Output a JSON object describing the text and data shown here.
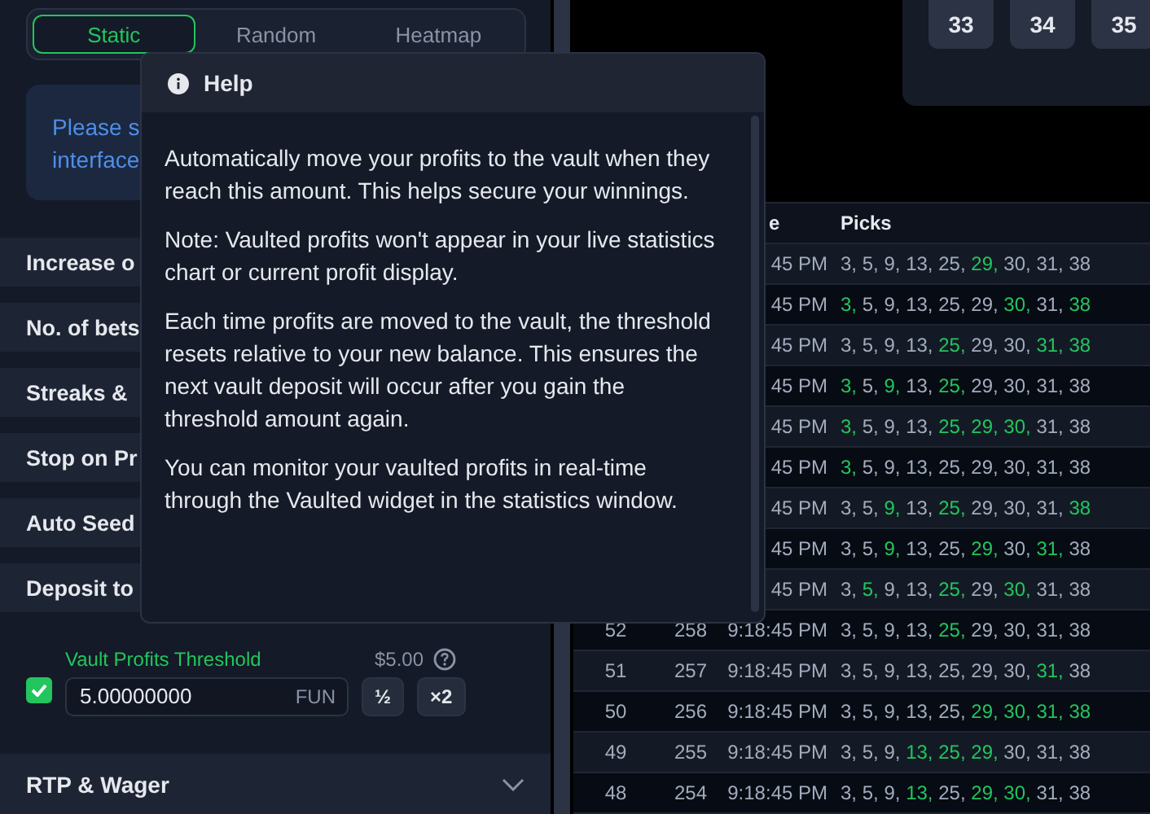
{
  "tabs": [
    {
      "label": "Static",
      "selected": true
    },
    {
      "label": "Random",
      "selected": false
    },
    {
      "label": "Heatmap",
      "selected": false
    }
  ],
  "notice": [
    "Please s",
    "interface"
  ],
  "sections": [
    {
      "label": "Increase o"
    },
    {
      "label": "No. of bets"
    },
    {
      "label": "Streaks &"
    },
    {
      "label": "Stop on Pr"
    },
    {
      "label": "Auto Seed"
    },
    {
      "label": "Deposit to"
    }
  ],
  "vault": {
    "checked": true,
    "label": "Vault Profits Threshold",
    "usd": "$5.00",
    "value": "5.00000000",
    "currency": "FUN",
    "half": "½",
    "double": "×2"
  },
  "footer_section": {
    "label": "RTP & Wager"
  },
  "tiles": [
    "33",
    "34",
    "35"
  ],
  "help": {
    "title": "Help",
    "paragraphs": [
      "Automatically move your profits to the vault when they reach this amount. This helps secure your winnings.",
      "Note: Vaulted profits won't appear in your live statistics chart or current profit display.",
      "Each time profits are moved to the vault, the threshold resets relative to your new balance. This ensures the next vault deposit will occur after you gain the threshold amount again.",
      "You can monitor your vaulted profits in real-time through the Vaulted widget in the statistics window."
    ]
  },
  "table": {
    "columns": [
      "e",
      "Picks"
    ],
    "rows": [
      {
        "time": "45 PM",
        "picks": [
          {
            "n": "3,",
            "hit": false
          },
          {
            "n": "5,",
            "hit": false
          },
          {
            "n": "9,",
            "hit": false
          },
          {
            "n": "13,",
            "hit": false
          },
          {
            "n": "25,",
            "hit": false
          },
          {
            "n": "29,",
            "hit": true
          },
          {
            "n": "30,",
            "hit": false
          },
          {
            "n": "31,",
            "hit": false
          },
          {
            "n": "38",
            "hit": false
          }
        ]
      },
      {
        "time": "45 PM",
        "picks": [
          {
            "n": "3,",
            "hit": true
          },
          {
            "n": "5,",
            "hit": false
          },
          {
            "n": "9,",
            "hit": false
          },
          {
            "n": "13,",
            "hit": false
          },
          {
            "n": "25,",
            "hit": false
          },
          {
            "n": "29,",
            "hit": false
          },
          {
            "n": "30,",
            "hit": true
          },
          {
            "n": "31,",
            "hit": false
          },
          {
            "n": "38",
            "hit": true
          }
        ]
      },
      {
        "time": "45 PM",
        "picks": [
          {
            "n": "3,",
            "hit": false
          },
          {
            "n": "5,",
            "hit": false
          },
          {
            "n": "9,",
            "hit": false
          },
          {
            "n": "13,",
            "hit": false
          },
          {
            "n": "25,",
            "hit": true
          },
          {
            "n": "29,",
            "hit": false
          },
          {
            "n": "30,",
            "hit": false
          },
          {
            "n": "31,",
            "hit": true
          },
          {
            "n": "38",
            "hit": true
          }
        ]
      },
      {
        "time": "45 PM",
        "picks": [
          {
            "n": "3,",
            "hit": true
          },
          {
            "n": "5,",
            "hit": false
          },
          {
            "n": "9,",
            "hit": true
          },
          {
            "n": "13,",
            "hit": false
          },
          {
            "n": "25,",
            "hit": true
          },
          {
            "n": "29,",
            "hit": false
          },
          {
            "n": "30,",
            "hit": false
          },
          {
            "n": "31,",
            "hit": false
          },
          {
            "n": "38",
            "hit": false
          }
        ]
      },
      {
        "time": "45 PM",
        "picks": [
          {
            "n": "3,",
            "hit": true
          },
          {
            "n": "5,",
            "hit": false
          },
          {
            "n": "9,",
            "hit": false
          },
          {
            "n": "13,",
            "hit": false
          },
          {
            "n": "25,",
            "hit": true
          },
          {
            "n": "29,",
            "hit": true
          },
          {
            "n": "30,",
            "hit": true
          },
          {
            "n": "31,",
            "hit": false
          },
          {
            "n": "38",
            "hit": false
          }
        ]
      },
      {
        "time": "45 PM",
        "picks": [
          {
            "n": "3,",
            "hit": true
          },
          {
            "n": "5,",
            "hit": false
          },
          {
            "n": "9,",
            "hit": false
          },
          {
            "n": "13,",
            "hit": false
          },
          {
            "n": "25,",
            "hit": false
          },
          {
            "n": "29,",
            "hit": false
          },
          {
            "n": "30,",
            "hit": false
          },
          {
            "n": "31,",
            "hit": false
          },
          {
            "n": "38",
            "hit": false
          }
        ]
      },
      {
        "time": "45 PM",
        "picks": [
          {
            "n": "3,",
            "hit": false
          },
          {
            "n": "5,",
            "hit": false
          },
          {
            "n": "9,",
            "hit": true
          },
          {
            "n": "13,",
            "hit": false
          },
          {
            "n": "25,",
            "hit": true
          },
          {
            "n": "29,",
            "hit": false
          },
          {
            "n": "30,",
            "hit": false
          },
          {
            "n": "31,",
            "hit": false
          },
          {
            "n": "38",
            "hit": true
          }
        ]
      },
      {
        "time": "45 PM",
        "picks": [
          {
            "n": "3,",
            "hit": false
          },
          {
            "n": "5,",
            "hit": false
          },
          {
            "n": "9,",
            "hit": true
          },
          {
            "n": "13,",
            "hit": false
          },
          {
            "n": "25,",
            "hit": false
          },
          {
            "n": "29,",
            "hit": true
          },
          {
            "n": "30,",
            "hit": false
          },
          {
            "n": "31,",
            "hit": true
          },
          {
            "n": "38",
            "hit": false
          }
        ]
      },
      {
        "time": "45 PM",
        "picks": [
          {
            "n": "3,",
            "hit": false
          },
          {
            "n": "5,",
            "hit": true
          },
          {
            "n": "9,",
            "hit": false
          },
          {
            "n": "13,",
            "hit": false
          },
          {
            "n": "25,",
            "hit": true
          },
          {
            "n": "29,",
            "hit": false
          },
          {
            "n": "30,",
            "hit": true
          },
          {
            "n": "31,",
            "hit": false
          },
          {
            "n": "38",
            "hit": false
          }
        ]
      },
      {
        "index": "52",
        "round": "258",
        "time": "9:18:45 PM",
        "picks": [
          {
            "n": "3,",
            "hit": false
          },
          {
            "n": "5,",
            "hit": false
          },
          {
            "n": "9,",
            "hit": false
          },
          {
            "n": "13,",
            "hit": false
          },
          {
            "n": "25,",
            "hit": true
          },
          {
            "n": "29,",
            "hit": false
          },
          {
            "n": "30,",
            "hit": false
          },
          {
            "n": "31,",
            "hit": false
          },
          {
            "n": "38",
            "hit": false
          }
        ]
      },
      {
        "index": "51",
        "round": "257",
        "time": "9:18:45 PM",
        "picks": [
          {
            "n": "3,",
            "hit": false
          },
          {
            "n": "5,",
            "hit": false
          },
          {
            "n": "9,",
            "hit": false
          },
          {
            "n": "13,",
            "hit": false
          },
          {
            "n": "25,",
            "hit": false
          },
          {
            "n": "29,",
            "hit": false
          },
          {
            "n": "30,",
            "hit": false
          },
          {
            "n": "31,",
            "hit": true
          },
          {
            "n": "38",
            "hit": false
          }
        ]
      },
      {
        "index": "50",
        "round": "256",
        "time": "9:18:45 PM",
        "picks": [
          {
            "n": "3,",
            "hit": false
          },
          {
            "n": "5,",
            "hit": false
          },
          {
            "n": "9,",
            "hit": false
          },
          {
            "n": "13,",
            "hit": false
          },
          {
            "n": "25,",
            "hit": false
          },
          {
            "n": "29,",
            "hit": true
          },
          {
            "n": "30,",
            "hit": true
          },
          {
            "n": "31,",
            "hit": true
          },
          {
            "n": "38",
            "hit": true
          }
        ]
      },
      {
        "index": "49",
        "round": "255",
        "time": "9:18:45 PM",
        "picks": [
          {
            "n": "3,",
            "hit": false
          },
          {
            "n": "5,",
            "hit": false
          },
          {
            "n": "9,",
            "hit": false
          },
          {
            "n": "13,",
            "hit": true
          },
          {
            "n": "25,",
            "hit": true
          },
          {
            "n": "29,",
            "hit": true
          },
          {
            "n": "30,",
            "hit": false
          },
          {
            "n": "31,",
            "hit": false
          },
          {
            "n": "38",
            "hit": false
          }
        ]
      },
      {
        "index": "48",
        "round": "254",
        "time": "9:18:45 PM",
        "picks": [
          {
            "n": "3,",
            "hit": false
          },
          {
            "n": "5,",
            "hit": false
          },
          {
            "n": "9,",
            "hit": false
          },
          {
            "n": "13,",
            "hit": true
          },
          {
            "n": "25,",
            "hit": false
          },
          {
            "n": "29,",
            "hit": true
          },
          {
            "n": "30,",
            "hit": true
          },
          {
            "n": "31,",
            "hit": false
          },
          {
            "n": "38",
            "hit": false
          }
        ]
      }
    ]
  }
}
